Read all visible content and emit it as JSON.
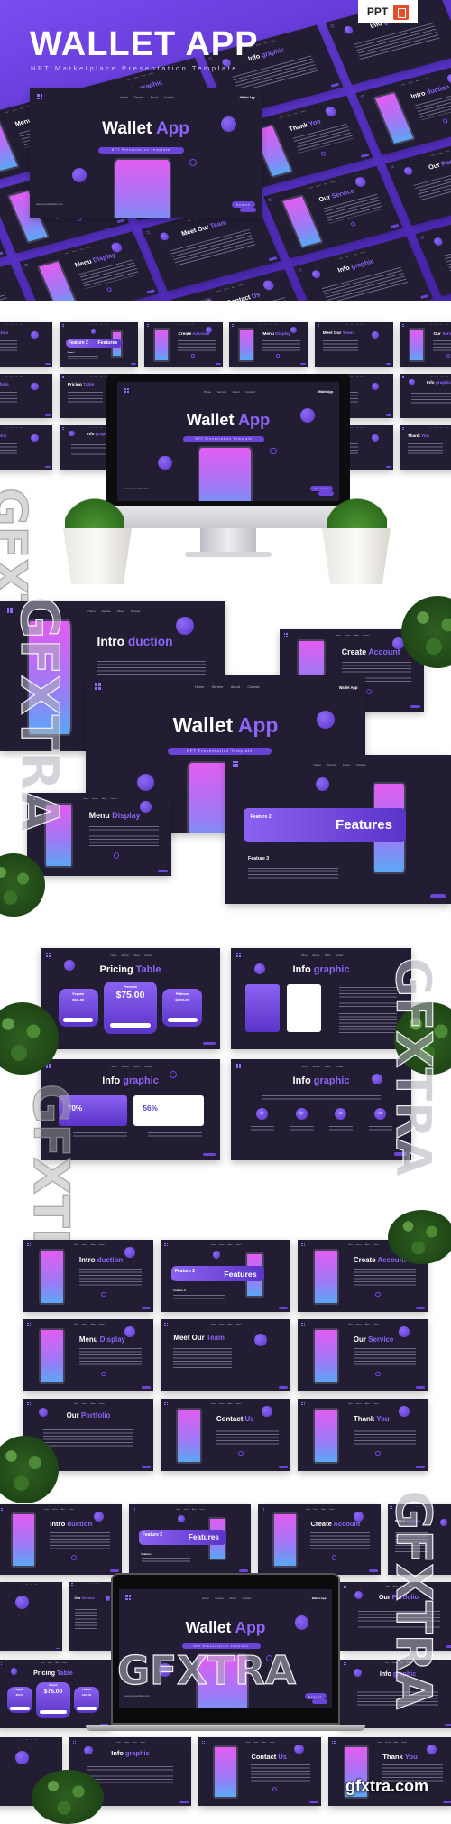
{
  "header": {
    "title": "WALLET APP",
    "subtitle": "NFT Marketplace Presentation Template",
    "badge": "PPT",
    "badge_icon": "powerpoint-icon"
  },
  "cover": {
    "title_white": "Wallet",
    "title_accent": "App",
    "tagline": "NFT Presentation Template",
    "nav": [
      "Home",
      "Service",
      "About",
      "Contact"
    ],
    "brand": "Wallet App",
    "website": "www.yourwebsite.com",
    "search": "Search"
  },
  "slides": {
    "intro": {
      "w": "Intro",
      "a": "duction"
    },
    "features": {
      "w": "Features",
      "a": "",
      "item": "Feature 2",
      "item3": "Feature 3"
    },
    "create": {
      "w": "Create",
      "a": "Account"
    },
    "menu": {
      "w": "Menu",
      "a": "Display"
    },
    "team": {
      "w": "Meet Our",
      "a": "Team"
    },
    "service": {
      "w": "Our",
      "a": "Service"
    },
    "portfolio": {
      "w": "Our",
      "a": "Portfolio"
    },
    "pricing": {
      "w": "Pricing",
      "a": "Table"
    },
    "info": {
      "w": "Info",
      "a": "graphic"
    },
    "contact": {
      "w": "Contact",
      "a": "Us"
    },
    "thanks": {
      "w": "Thank",
      "a": "You"
    }
  },
  "pricing": {
    "plans": [
      {
        "name": "Regular",
        "price": "$50.00"
      },
      {
        "name": "Premium",
        "price": "$75.00"
      },
      {
        "name": "Platinum",
        "price": "$100.00"
      }
    ]
  },
  "infographic": {
    "pct1": "70%",
    "pct2": "56%",
    "steps": [
      "01",
      "02",
      "03",
      "04"
    ]
  },
  "watermark": {
    "text": "GFXTRA",
    "site": "gfxtra.com"
  },
  "colors": {
    "accent": "#8d65f6",
    "slide_bg": "#221d33",
    "hero_bg": "#5b34cc"
  }
}
